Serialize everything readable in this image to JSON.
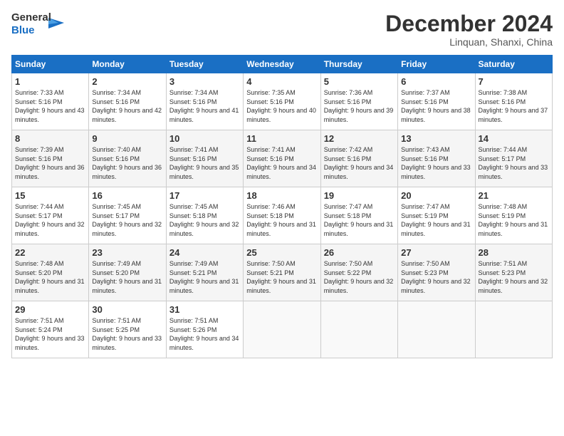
{
  "header": {
    "logo_general": "General",
    "logo_blue": "Blue",
    "month_title": "December 2024",
    "location": "Linquan, Shanxi, China"
  },
  "days_of_week": [
    "Sunday",
    "Monday",
    "Tuesday",
    "Wednesday",
    "Thursday",
    "Friday",
    "Saturday"
  ],
  "weeks": [
    [
      {
        "day": "1",
        "sunrise": "Sunrise: 7:33 AM",
        "sunset": "Sunset: 5:16 PM",
        "daylight": "Daylight: 9 hours and 43 minutes."
      },
      {
        "day": "2",
        "sunrise": "Sunrise: 7:34 AM",
        "sunset": "Sunset: 5:16 PM",
        "daylight": "Daylight: 9 hours and 42 minutes."
      },
      {
        "day": "3",
        "sunrise": "Sunrise: 7:34 AM",
        "sunset": "Sunset: 5:16 PM",
        "daylight": "Daylight: 9 hours and 41 minutes."
      },
      {
        "day": "4",
        "sunrise": "Sunrise: 7:35 AM",
        "sunset": "Sunset: 5:16 PM",
        "daylight": "Daylight: 9 hours and 40 minutes."
      },
      {
        "day": "5",
        "sunrise": "Sunrise: 7:36 AM",
        "sunset": "Sunset: 5:16 PM",
        "daylight": "Daylight: 9 hours and 39 minutes."
      },
      {
        "day": "6",
        "sunrise": "Sunrise: 7:37 AM",
        "sunset": "Sunset: 5:16 PM",
        "daylight": "Daylight: 9 hours and 38 minutes."
      },
      {
        "day": "7",
        "sunrise": "Sunrise: 7:38 AM",
        "sunset": "Sunset: 5:16 PM",
        "daylight": "Daylight: 9 hours and 37 minutes."
      }
    ],
    [
      {
        "day": "8",
        "sunrise": "Sunrise: 7:39 AM",
        "sunset": "Sunset: 5:16 PM",
        "daylight": "Daylight: 9 hours and 36 minutes."
      },
      {
        "day": "9",
        "sunrise": "Sunrise: 7:40 AM",
        "sunset": "Sunset: 5:16 PM",
        "daylight": "Daylight: 9 hours and 36 minutes."
      },
      {
        "day": "10",
        "sunrise": "Sunrise: 7:41 AM",
        "sunset": "Sunset: 5:16 PM",
        "daylight": "Daylight: 9 hours and 35 minutes."
      },
      {
        "day": "11",
        "sunrise": "Sunrise: 7:41 AM",
        "sunset": "Sunset: 5:16 PM",
        "daylight": "Daylight: 9 hours and 34 minutes."
      },
      {
        "day": "12",
        "sunrise": "Sunrise: 7:42 AM",
        "sunset": "Sunset: 5:16 PM",
        "daylight": "Daylight: 9 hours and 34 minutes."
      },
      {
        "day": "13",
        "sunrise": "Sunrise: 7:43 AM",
        "sunset": "Sunset: 5:16 PM",
        "daylight": "Daylight: 9 hours and 33 minutes."
      },
      {
        "day": "14",
        "sunrise": "Sunrise: 7:44 AM",
        "sunset": "Sunset: 5:17 PM",
        "daylight": "Daylight: 9 hours and 33 minutes."
      }
    ],
    [
      {
        "day": "15",
        "sunrise": "Sunrise: 7:44 AM",
        "sunset": "Sunset: 5:17 PM",
        "daylight": "Daylight: 9 hours and 32 minutes."
      },
      {
        "day": "16",
        "sunrise": "Sunrise: 7:45 AM",
        "sunset": "Sunset: 5:17 PM",
        "daylight": "Daylight: 9 hours and 32 minutes."
      },
      {
        "day": "17",
        "sunrise": "Sunrise: 7:45 AM",
        "sunset": "Sunset: 5:18 PM",
        "daylight": "Daylight: 9 hours and 32 minutes."
      },
      {
        "day": "18",
        "sunrise": "Sunrise: 7:46 AM",
        "sunset": "Sunset: 5:18 PM",
        "daylight": "Daylight: 9 hours and 31 minutes."
      },
      {
        "day": "19",
        "sunrise": "Sunrise: 7:47 AM",
        "sunset": "Sunset: 5:18 PM",
        "daylight": "Daylight: 9 hours and 31 minutes."
      },
      {
        "day": "20",
        "sunrise": "Sunrise: 7:47 AM",
        "sunset": "Sunset: 5:19 PM",
        "daylight": "Daylight: 9 hours and 31 minutes."
      },
      {
        "day": "21",
        "sunrise": "Sunrise: 7:48 AM",
        "sunset": "Sunset: 5:19 PM",
        "daylight": "Daylight: 9 hours and 31 minutes."
      }
    ],
    [
      {
        "day": "22",
        "sunrise": "Sunrise: 7:48 AM",
        "sunset": "Sunset: 5:20 PM",
        "daylight": "Daylight: 9 hours and 31 minutes."
      },
      {
        "day": "23",
        "sunrise": "Sunrise: 7:49 AM",
        "sunset": "Sunset: 5:20 PM",
        "daylight": "Daylight: 9 hours and 31 minutes."
      },
      {
        "day": "24",
        "sunrise": "Sunrise: 7:49 AM",
        "sunset": "Sunset: 5:21 PM",
        "daylight": "Daylight: 9 hours and 31 minutes."
      },
      {
        "day": "25",
        "sunrise": "Sunrise: 7:50 AM",
        "sunset": "Sunset: 5:21 PM",
        "daylight": "Daylight: 9 hours and 31 minutes."
      },
      {
        "day": "26",
        "sunrise": "Sunrise: 7:50 AM",
        "sunset": "Sunset: 5:22 PM",
        "daylight": "Daylight: 9 hours and 32 minutes."
      },
      {
        "day": "27",
        "sunrise": "Sunrise: 7:50 AM",
        "sunset": "Sunset: 5:23 PM",
        "daylight": "Daylight: 9 hours and 32 minutes."
      },
      {
        "day": "28",
        "sunrise": "Sunrise: 7:51 AM",
        "sunset": "Sunset: 5:23 PM",
        "daylight": "Daylight: 9 hours and 32 minutes."
      }
    ],
    [
      {
        "day": "29",
        "sunrise": "Sunrise: 7:51 AM",
        "sunset": "Sunset: 5:24 PM",
        "daylight": "Daylight: 9 hours and 33 minutes."
      },
      {
        "day": "30",
        "sunrise": "Sunrise: 7:51 AM",
        "sunset": "Sunset: 5:25 PM",
        "daylight": "Daylight: 9 hours and 33 minutes."
      },
      {
        "day": "31",
        "sunrise": "Sunrise: 7:51 AM",
        "sunset": "Sunset: 5:26 PM",
        "daylight": "Daylight: 9 hours and 34 minutes."
      },
      null,
      null,
      null,
      null
    ]
  ]
}
